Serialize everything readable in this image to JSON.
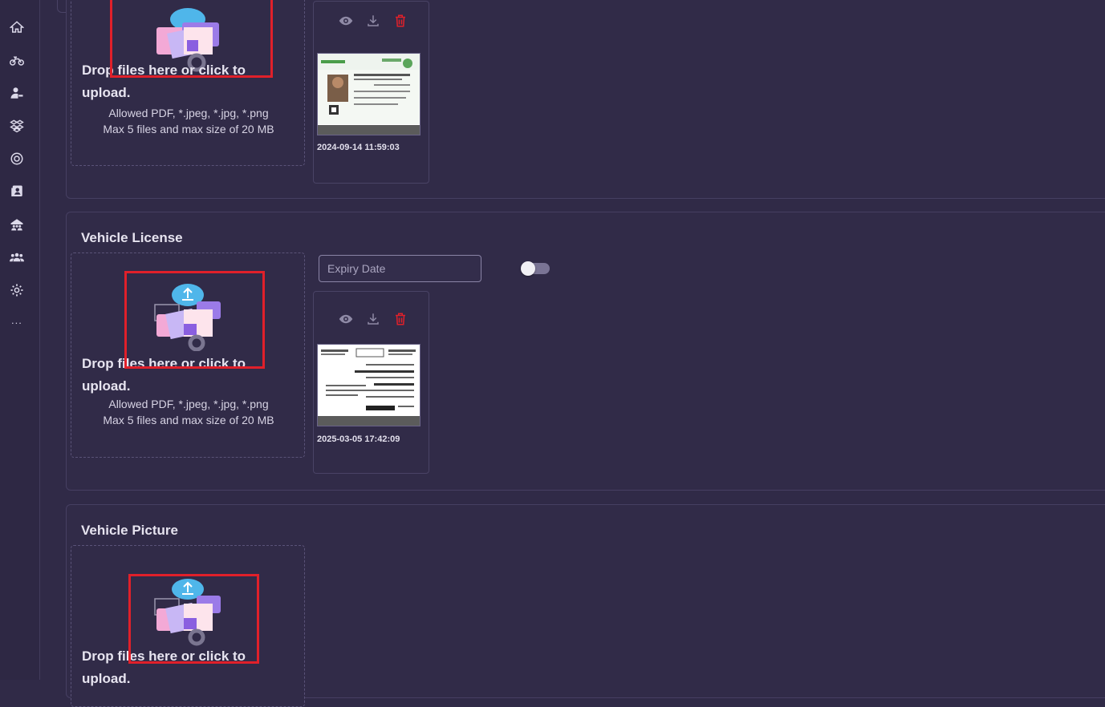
{
  "sidebar": {
    "icons": [
      "home-icon",
      "motorbike-icon",
      "user-key-icon",
      "boxes-icon",
      "support-icon",
      "contacts-book-icon",
      "warehouse-icon",
      "team-icon",
      "gear-icon"
    ],
    "more_label": "..."
  },
  "dropzone": {
    "main_text": "Drop files here or click to upload.",
    "allowed": "Allowed PDF, *.jpeg, *.jpg, *.png",
    "limits": "Max 5 files and max size of 20 MB"
  },
  "sections": {
    "driver_id": {
      "file_timestamp": "2024-09-14 11:59:03"
    },
    "vehicle_license": {
      "title": "Vehicle License",
      "expiry_placeholder": "Expiry Date",
      "file_timestamp": "2025-03-05 17:42:09"
    },
    "vehicle_picture": {
      "title": "Vehicle Picture"
    }
  },
  "colors": {
    "background": "#302a47",
    "highlight": "#e0202a",
    "delete": "#e0202a"
  }
}
